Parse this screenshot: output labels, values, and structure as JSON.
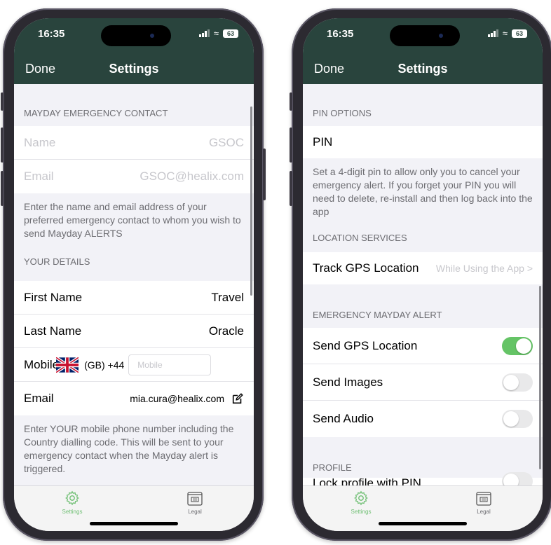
{
  "status": {
    "time": "16:35",
    "battery": "63"
  },
  "nav": {
    "done_label": "Done",
    "title": "Settings"
  },
  "left": {
    "mayday_header": "MAYDAY EMERGENCY CONTACT",
    "contact_name": {
      "label": "Name",
      "value": "GSOC"
    },
    "contact_email": {
      "label": "Email",
      "value": "GSOC@healix.com"
    },
    "contact_note": "Enter the name and email address of your preferred emergency contact to whom you wish to send Mayday ALERTS",
    "details_header": "YOUR DETAILS",
    "first_name": {
      "label": "First Name",
      "value": "Travel"
    },
    "last_name": {
      "label": "Last Name",
      "value": "Oracle"
    },
    "mobile": {
      "label": "Mobile",
      "country": "(GB) +44",
      "placeholder": "Mobile"
    },
    "email": {
      "label": "Email",
      "value": "mia.cura@healix.com"
    },
    "details_note": "Enter YOUR mobile phone number including the Country dialling code. This will be sent to your emergency contact when the Mayday alert is triggered."
  },
  "right": {
    "pin_header": "PIN OPTIONS",
    "pin_label": "PIN",
    "pin_note": "Set a 4-digit pin to allow only you to cancel your emergency alert. If you forget your PIN you will need to delete, re-install and then log back into the app",
    "location_header": "LOCATION SERVICES",
    "track_gps": {
      "label": "Track GPS Location",
      "value": "While Using the App >"
    },
    "alert_header": "EMERGENCY MAYDAY ALERT",
    "send_gps": {
      "label": "Send GPS Location",
      "on": true
    },
    "send_images": {
      "label": "Send Images",
      "on": false
    },
    "send_audio": {
      "label": "Send Audio",
      "on": false
    },
    "profile_header": "PROFILE",
    "lock_profile": {
      "label": "Lock profile with PIN",
      "on": false
    }
  },
  "tabs": {
    "settings": "Settings",
    "legal": "Legal"
  },
  "colors": {
    "nav_bg": "#29443d",
    "toggle_on": "#65c466",
    "tab_active": "#6fbf73"
  },
  "icons": {
    "settings_tab": "gear-icon",
    "legal_tab": "document-icon",
    "edit": "edit-icon",
    "flag": "uk-flag-icon"
  }
}
